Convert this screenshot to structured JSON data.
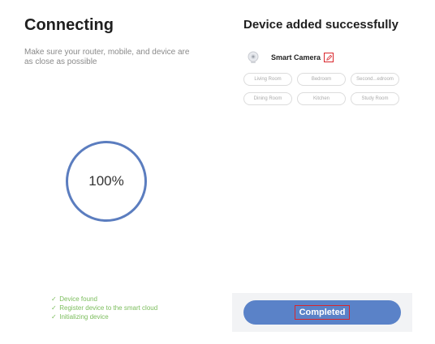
{
  "connecting": {
    "title": "Connecting",
    "description": "Make sure your router, mobile, and device are as close as possible",
    "progress_label": "100%",
    "progress_fraction": 1.0,
    "steps": [
      {
        "check": "✓",
        "label": "Device found"
      },
      {
        "check": "✓",
        "label": "Register device to the smart cloud"
      },
      {
        "check": "✓",
        "label": "Initializing device"
      }
    ]
  },
  "added": {
    "title": "Device added successfully",
    "device_name": "Smart Camera",
    "rooms": [
      "Living Room",
      "Bedroom",
      "Second...edroom",
      "Dining Room",
      "Kitchen",
      "Study Room"
    ],
    "completed_label": "Completed"
  },
  "colors": {
    "accent_blue": "#5a82c8",
    "ring_blue": "#5b7dbf",
    "step_green": "#7bbd5c",
    "highlight_red": "#d9262c"
  },
  "icons": {
    "camera": "camera-icon",
    "edit": "pencil-icon",
    "step_check": "check-icon"
  }
}
